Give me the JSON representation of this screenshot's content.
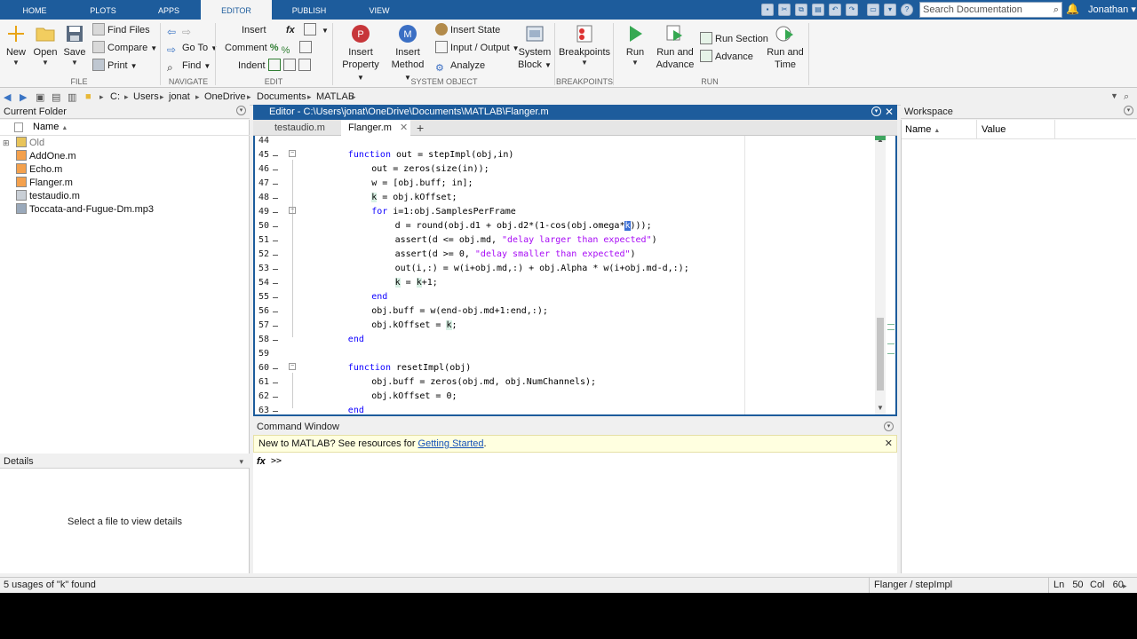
{
  "tabs": [
    "HOME",
    "PLOTS",
    "APPS",
    "EDITOR",
    "PUBLISH",
    "VIEW"
  ],
  "search_placeholder": "Search Documentation",
  "user": "Jonathan",
  "toolstrip": {
    "file": {
      "label": "FILE",
      "new": "New",
      "open": "Open",
      "save": "Save",
      "find_files": "Find Files",
      "compare": "Compare",
      "print": "Print"
    },
    "navigate": {
      "label": "NAVIGATE",
      "goto": "Go To",
      "find": "Find"
    },
    "edit": {
      "label": "EDIT",
      "insert": "Insert",
      "comment": "Comment",
      "indent": "Indent",
      "fx": "fx"
    },
    "system_object": {
      "label": "SYSTEM OBJECT",
      "insert_property": [
        "Insert",
        "Property"
      ],
      "insert_method": [
        "Insert",
        "Method"
      ],
      "insert_state": "Insert State",
      "input_output": "Input / Output",
      "analyze": "Analyze",
      "system_block": [
        "System",
        "Block"
      ]
    },
    "breakpoints": {
      "label": "BREAKPOINTS",
      "breakpoints": "Breakpoints"
    },
    "run": {
      "label": "RUN",
      "run": "Run",
      "run_and_advance": [
        "Run and",
        "Advance"
      ],
      "run_section": "Run Section",
      "advance": "Advance",
      "run_and_time": [
        "Run and",
        "Time"
      ]
    }
  },
  "address": [
    "C:",
    "Users",
    "jonat",
    "OneDrive",
    "Documents",
    "MATLAB"
  ],
  "current_folder": {
    "title": "Current Folder",
    "col_name": "Name",
    "sort": "▲",
    "items": [
      {
        "name": "Old",
        "type": "folder"
      },
      {
        "name": "AddOne.m",
        "type": "mfile"
      },
      {
        "name": "Echo.m",
        "type": "mfile"
      },
      {
        "name": "Flanger.m",
        "type": "mfile"
      },
      {
        "name": "testaudio.m",
        "type": "script"
      },
      {
        "name": "Toccata-and-Fugue-Dm.mp3",
        "type": "audio"
      }
    ]
  },
  "details": {
    "title": "Details",
    "message": "Select a file to view details"
  },
  "editor": {
    "title": "Editor - C:\\Users\\jonat\\OneDrive\\Documents\\MATLAB\\Flanger.m",
    "tabs": [
      {
        "label": "testaudio.m",
        "active": false
      },
      {
        "label": "Flanger.m",
        "active": true
      }
    ],
    "add_tab": "+",
    "lines": [
      {
        "n": "44",
        "indent": 0,
        "segs": []
      },
      {
        "n": "45",
        "indent": 2,
        "segs": [
          {
            "t": "function",
            "c": "kw"
          },
          {
            "t": " out = stepImpl(obj,in)"
          }
        ]
      },
      {
        "n": "46",
        "indent": 3,
        "segs": [
          {
            "t": "out = zeros(size(in));"
          }
        ]
      },
      {
        "n": "47",
        "indent": 3,
        "segs": [
          {
            "t": "w = [obj.buff; in];"
          }
        ]
      },
      {
        "n": "48",
        "indent": 3,
        "segs": [
          {
            "t": "k",
            "c": "hl"
          },
          {
            "t": " = obj.kOffset;"
          }
        ]
      },
      {
        "n": "49",
        "indent": 3,
        "segs": [
          {
            "t": "for",
            "c": "kw"
          },
          {
            "t": " i=1:obj.SamplesPerFrame"
          }
        ]
      },
      {
        "n": "50",
        "indent": 4,
        "segs": [
          {
            "t": "d = round(obj.d1 + obj.d2*(1-cos(obj.omega*"
          },
          {
            "t": "k",
            "c": "sel"
          },
          {
            "t": ")));"
          }
        ]
      },
      {
        "n": "51",
        "indent": 4,
        "segs": [
          {
            "t": "assert(d <= obj.md, "
          },
          {
            "t": "\"delay larger than expected\"",
            "c": "str"
          },
          {
            "t": ")"
          }
        ]
      },
      {
        "n": "52",
        "indent": 4,
        "segs": [
          {
            "t": "assert(d >= 0, "
          },
          {
            "t": "\"delay smaller than expected\"",
            "c": "str"
          },
          {
            "t": ")"
          }
        ]
      },
      {
        "n": "53",
        "indent": 4,
        "segs": [
          {
            "t": "out(i,:) = w(i+obj.md,:) + obj.Alpha * w(i+obj.md-d,:);"
          }
        ]
      },
      {
        "n": "54",
        "indent": 4,
        "segs": [
          {
            "t": "k",
            "c": "hl"
          },
          {
            "t": " = "
          },
          {
            "t": "k",
            "c": "hl"
          },
          {
            "t": "+1;"
          }
        ]
      },
      {
        "n": "55",
        "indent": 3,
        "segs": [
          {
            "t": "end",
            "c": "kw"
          }
        ]
      },
      {
        "n": "56",
        "indent": 3,
        "segs": [
          {
            "t": "obj.buff = w(end-obj.md+1:end,:);"
          }
        ]
      },
      {
        "n": "57",
        "indent": 3,
        "segs": [
          {
            "t": "obj.kOffset = "
          },
          {
            "t": "k",
            "c": "hl"
          },
          {
            "t": ";"
          }
        ]
      },
      {
        "n": "58",
        "indent": 2,
        "segs": [
          {
            "t": "end",
            "c": "kw"
          }
        ]
      },
      {
        "n": "59",
        "indent": 0,
        "segs": []
      },
      {
        "n": "60",
        "indent": 2,
        "segs": [
          {
            "t": "function",
            "c": "kw"
          },
          {
            "t": " resetImpl(obj)"
          }
        ]
      },
      {
        "n": "61",
        "indent": 3,
        "segs": [
          {
            "t": "obj.buff = zeros(obj.md, obj.NumChannels);"
          }
        ]
      },
      {
        "n": "62",
        "indent": 3,
        "segs": [
          {
            "t": "obj.kOffset = 0;"
          }
        ]
      },
      {
        "n": "63",
        "indent": 2,
        "segs": [
          {
            "t": "end",
            "c": "kw"
          }
        ]
      }
    ]
  },
  "command_window": {
    "title": "Command Window",
    "msg_prefix": "New to MATLAB? See resources for ",
    "msg_link": "Getting Started",
    "msg_suffix": ".",
    "fx": "fx",
    "prompt": ">>"
  },
  "workspace": {
    "title": "Workspace",
    "col_name": "Name",
    "col_value": "Value",
    "sort": "▲"
  },
  "status": {
    "left": "5 usages of \"k\" found",
    "context": "Flanger / stepImpl",
    "ln_label": "Ln",
    "ln": "50",
    "col_label": "Col",
    "col": "60"
  },
  "colors": {
    "titlebar": "#1d5c9c",
    "keyword": "#0e00ff",
    "string": "#a709f5",
    "highlight": "#d8f0e4"
  }
}
